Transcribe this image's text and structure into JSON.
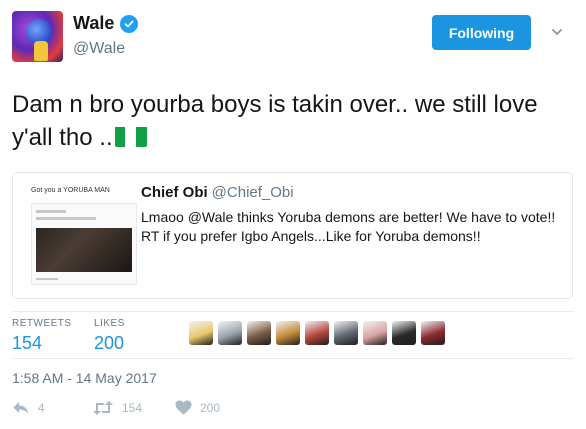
{
  "author": {
    "display_name": "Wale",
    "handle": "@Wale",
    "verified": true
  },
  "follow_button": {
    "label": "Following",
    "color": "#1b95e0"
  },
  "tweet": {
    "text": "Dam n bro yourba boys is takin over.. we still love y'all tho ..",
    "emoji": "nigeria-flag"
  },
  "quoted_tweet": {
    "thumbnail_caption": "Got you a YORUBA MAN",
    "display_name": "Chief Obi",
    "handle": "@Chief_Obi",
    "text": "Lmaoo @Wale thinks Yoruba demons are better! We have to vote!! RT if you prefer Igbo Angels...Like for Yoruba demons!!"
  },
  "stats": {
    "retweets_label": "RETWEETS",
    "retweets_value": "154",
    "likes_label": "LIKES",
    "likes_value": "200",
    "liker_avatar_colors": [
      "#e8c86a",
      "#9aa3ad",
      "#7a5b44",
      "#c48a3a",
      "#b3463c",
      "#5e6670",
      "#d9a3a0",
      "#2a2a2a",
      "#8c2a30"
    ]
  },
  "timestamp": "1:58 AM - 14 May 2017",
  "actions": {
    "reply_count": "4",
    "retweet_count": "154",
    "like_count": "200"
  },
  "colors": {
    "accent": "#1b95e0",
    "muted": "#657786",
    "icon": "#aab8c2",
    "border": "#e1e8ed"
  }
}
